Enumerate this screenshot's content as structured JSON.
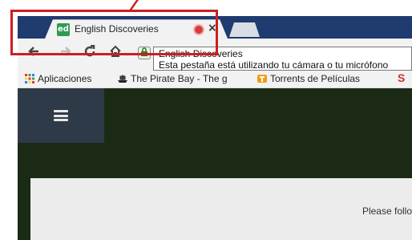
{
  "tab": {
    "favicon_text": "ed",
    "title": "English Discoveries",
    "close_glyph": "×"
  },
  "tooltip": {
    "line1": "English Discoveries",
    "line2": "Esta pestaña está utilizando tu cámara o tu micrófono"
  },
  "bookmarks": {
    "items": [
      {
        "label": "Aplicaciones"
      },
      {
        "label": "The Pirate Bay - The g"
      },
      {
        "label": "Torrents de Películas"
      }
    ]
  },
  "page": {
    "instructions": "Please follo"
  },
  "colors": {
    "highlight": "#cc1f1f",
    "recording": "#d83b3b",
    "page_bg": "#1a2a15",
    "menu_bg": "#2f3a48"
  }
}
